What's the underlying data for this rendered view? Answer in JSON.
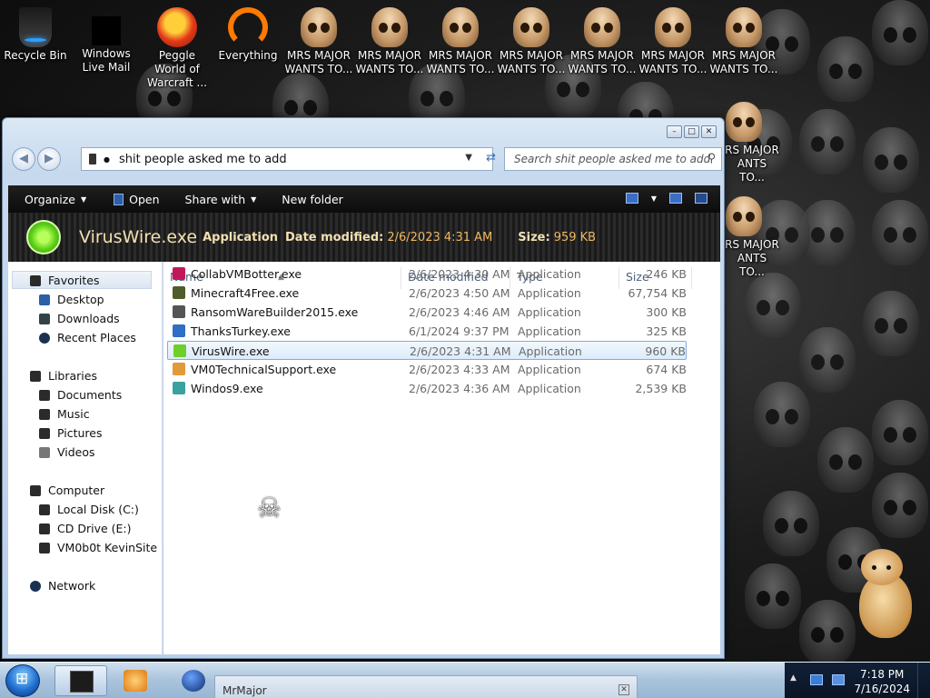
{
  "desktop": {
    "icons": [
      {
        "label": "Recycle Bin",
        "icon": "recycle-bin-icon"
      },
      {
        "label": "Windows Live Mail",
        "icon": "windows-live-mail-icon"
      },
      {
        "label": "Peggle World of Warcraft ...",
        "icon": "peggle-icon"
      },
      {
        "label": "Everything",
        "icon": "everything-icon"
      },
      {
        "label": "MRS MAJOR WANTS TO...",
        "icon": "skull-icon"
      },
      {
        "label": "MRS MAJOR WANTS TO...",
        "icon": "skull-icon"
      },
      {
        "label": "MRS MAJOR WANTS TO...",
        "icon": "skull-icon"
      },
      {
        "label": "MRS MAJOR WANTS TO...",
        "icon": "skull-icon"
      },
      {
        "label": "MRS MAJOR WANTS TO...",
        "icon": "skull-icon"
      },
      {
        "label": "MRS MAJOR WANTS TO...",
        "icon": "skull-icon"
      },
      {
        "label": "MRS MAJOR WANTS TO...",
        "icon": "skull-icon"
      },
      {
        "label": "RS MAJOR ANTS TO...",
        "icon": "skull-icon"
      },
      {
        "label": "RS MAJOR ANTS TO...",
        "icon": "skull-icon"
      }
    ]
  },
  "explorer": {
    "address": "shit people asked me to add",
    "search_placeholder": "Search shit people asked me to add",
    "toolbar": {
      "organize": "Organize",
      "open": "Open",
      "share_with": "Share with",
      "new_folder": "New folder"
    },
    "details": {
      "name": "VirusWire.exe",
      "type": "Application",
      "date_label": "Date modified:",
      "date_value": "2/6/2023 4:31 AM",
      "size_label": "Size:",
      "size_value": "959 KB"
    },
    "nav": {
      "favorites": "Favorites",
      "desktop": "Desktop",
      "downloads": "Downloads",
      "recent_places": "Recent Places",
      "libraries": "Libraries",
      "documents": "Documents",
      "music": "Music",
      "pictures": "Pictures",
      "videos": "Videos",
      "computer": "Computer",
      "local_disk": "Local Disk (C:)",
      "cd_drive": "CD Drive (E:)",
      "vm0b0t": "VM0b0t KevinSite",
      "network": "Network"
    },
    "columns": {
      "name": "Name",
      "date": "Date modified",
      "type": "Type",
      "size": "Size"
    },
    "files": [
      {
        "name": "CollabVMBotter.exe",
        "date": "2/6/2023 4:30 AM",
        "type": "Application",
        "size": "246 KB",
        "color": "#c2185b"
      },
      {
        "name": "Minecraft4Free.exe",
        "date": "2/6/2023 4:50 AM",
        "type": "Application",
        "size": "67,754 KB",
        "color": "#4e5d2a"
      },
      {
        "name": "RansomWareBuilder2015.exe",
        "date": "2/6/2023 4:46 AM",
        "type": "Application",
        "size": "300 KB",
        "color": "#555555"
      },
      {
        "name": "ThanksTurkey.exe",
        "date": "6/1/2024 9:37 PM",
        "type": "Application",
        "size": "325 KB",
        "color": "#2f6fc6"
      },
      {
        "name": "VirusWire.exe",
        "date": "2/6/2023 4:31 AM",
        "type": "Application",
        "size": "960 KB",
        "color": "#6fcf2a",
        "selected": true
      },
      {
        "name": "VM0TechnicalSupport.exe",
        "date": "2/6/2023 4:33 AM",
        "type": "Application",
        "size": "674 KB",
        "color": "#e09a3a"
      },
      {
        "name": "Windos9.exe",
        "date": "2/6/2023 4:36 AM",
        "type": "Application",
        "size": "2,539 KB",
        "color": "#3aa0a0"
      }
    ]
  },
  "taskbar": {
    "mrmajor_title": "MrMajor",
    "time": "7:18 PM",
    "date": "7/16/2024"
  }
}
